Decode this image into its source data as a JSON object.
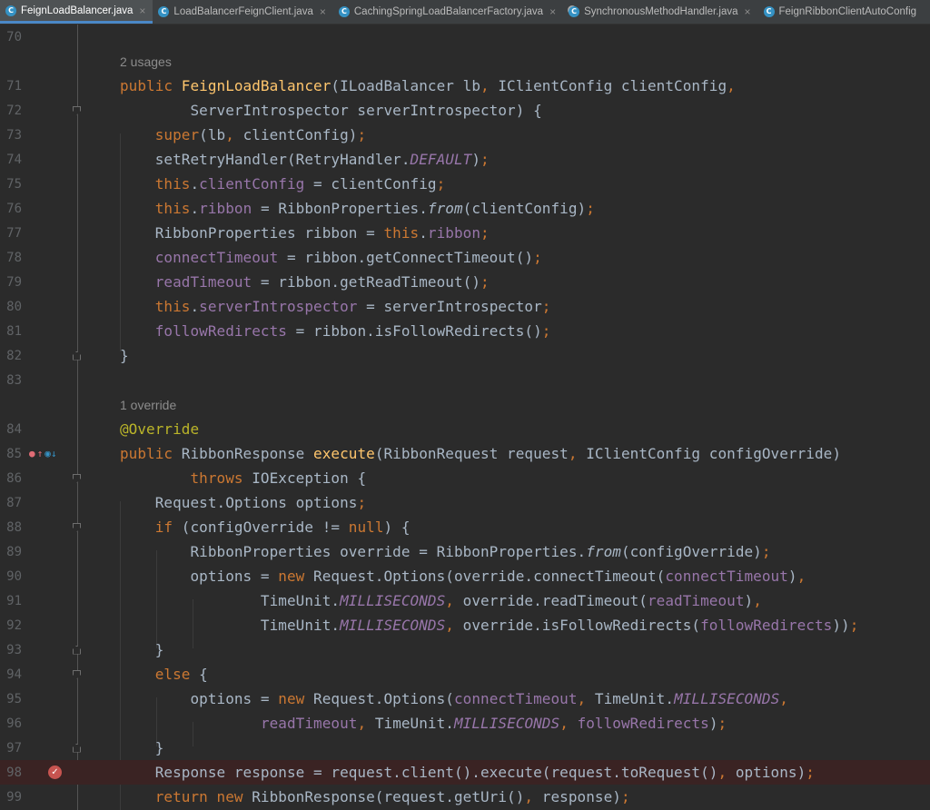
{
  "tabs": [
    {
      "name": "FeignLoadBalancer.java",
      "active": true,
      "close": "×"
    },
    {
      "name": "LoadBalancerFeignClient.java",
      "active": false,
      "close": "×"
    },
    {
      "name": "CachingSpringLoadBalancerFactory.java",
      "active": false,
      "close": "×"
    },
    {
      "name": "SynchronousMethodHandler.java",
      "active": false,
      "close": "×"
    },
    {
      "name": "FeignRibbonClientAutoConfig",
      "active": false,
      "close": ""
    }
  ],
  "editor": {
    "hints": {
      "usages": "2 usages",
      "override": "1 override"
    },
    "line_numbers": [
      "70",
      "71",
      "72",
      "73",
      "74",
      "75",
      "76",
      "77",
      "78",
      "79",
      "80",
      "81",
      "82",
      "83",
      "84",
      "85",
      "86",
      "87",
      "88",
      "89",
      "90",
      "91",
      "92",
      "93",
      "94",
      "95",
      "96",
      "97",
      "98",
      "99"
    ],
    "gutter": {
      "override_icons": [
        "implements-icon",
        "override-up-icon",
        "override-down-icon"
      ],
      "breakpoint_line": "98"
    },
    "colors": {
      "background": "#2b2b2b",
      "keyword": "#cc7832",
      "method": "#ffc66d",
      "field": "#9876aa",
      "annotation": "#bbb529",
      "text": "#a9b7c6",
      "breakpoint_line": "#3a2323"
    }
  }
}
